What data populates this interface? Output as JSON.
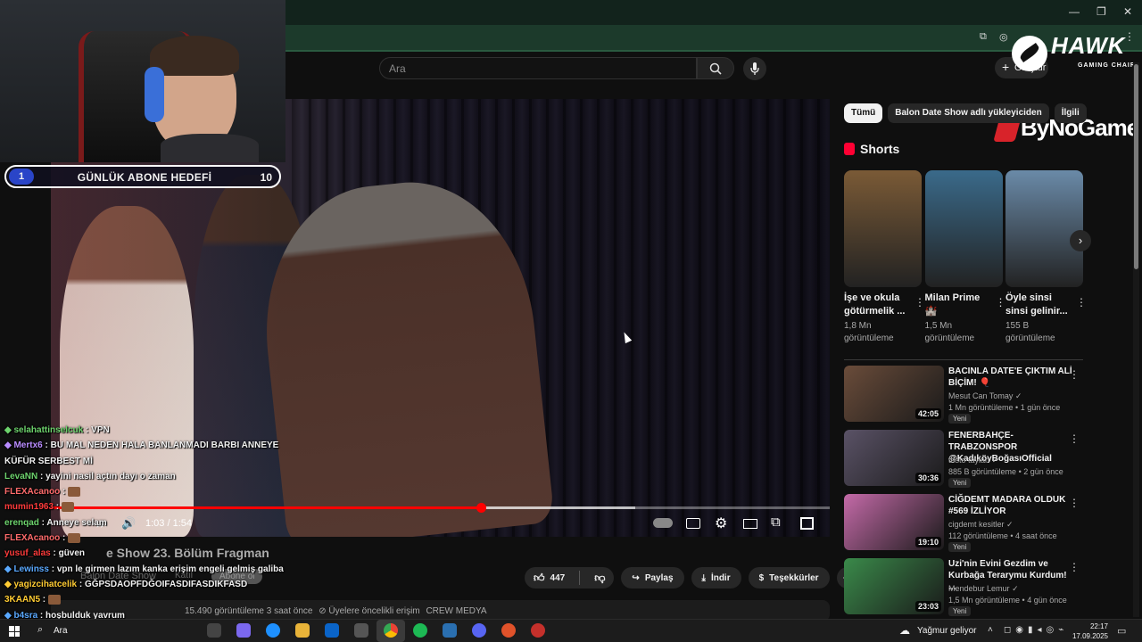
{
  "overlay": {
    "goal": {
      "current": "1",
      "label": "GÜNLÜK ABONE HEDEFİ",
      "target": "10",
      "fraction": 0.1
    },
    "brand_hawk": "HAWK",
    "brand_hawk_sub": "GAMING CHAIR",
    "brand_bynogame": "ByNoGame"
  },
  "chat": [
    {
      "user": "selahattinselcuk",
      "text": "VPN",
      "color": "#6dd36d",
      "badges": true
    },
    {
      "user": "Mertx6",
      "text": "BU MAL NEDEN HALA BANLANMADI BARBI ANNEYE KÜFÜR SERBEST Mİ",
      "color": "#b98cff",
      "badges": true
    },
    {
      "user": "LevaNN",
      "text": "yayini nasil açtın dayı o zaman",
      "color": "#6dd36d",
      "badges": false
    },
    {
      "user": "FLEXAcanoo",
      "text": "",
      "color": "#ff6b6b",
      "badges": false
    },
    {
      "user": "mumin1963",
      "text": "",
      "color": "#ff3b3b",
      "badges": false
    },
    {
      "user": "erenqad",
      "text": "Anneye selam",
      "color": "#6dd36d",
      "badges": false
    },
    {
      "user": "FLEXAcanoo",
      "text": "",
      "color": "#ff6b6b",
      "badges": false
    },
    {
      "user": "yusuf_alas",
      "text": "güven",
      "color": "#ff3b3b",
      "badges": false
    },
    {
      "user": "Lewinss",
      "text": "vpn le girmen lazım kanka erişim engeli gelmiş galiba",
      "color": "#5aa9ff",
      "badges": true
    },
    {
      "user": "yagizcihatcelik",
      "text": "GĞPSDAOPFDĞOIFASDIFASDIKFASD",
      "color": "#ffcc33",
      "badges": true
    },
    {
      "user": "3KAAN5",
      "text": "",
      "color": "#ffcc33",
      "badges": false
    },
    {
      "user": "b4sra",
      "text": "hoşbulduk yavrum",
      "color": "#5aa9ff",
      "badges": true
    }
  ],
  "youtube": {
    "search_placeholder": "Ara",
    "create_label": "Oluştur",
    "video": {
      "time": "1:03 / 1:54",
      "progress": 0.552,
      "buffered": 0.75,
      "title_visible": "e Show 23. Bölüm Fragman",
      "channel": "Balon Date Show",
      "join_label": "Katıl",
      "subscribe_label": "Abone ol",
      "likes": "447",
      "share_label": "Paylaş",
      "download_label": "İndir",
      "thanks_label": "Teşekkürler",
      "views_date": "15.490 görüntüleme 3 saat önce",
      "meta_extra": "Üyelere öncelikli erişim",
      "tag": "CREW MEDYA"
    },
    "chips": [
      "Tümü",
      "Balon Date Show adlı yükleyiciden",
      "İlgili"
    ],
    "shorts_title": "Shorts",
    "shorts": [
      {
        "title": "İşe ve okula götürmelik ...",
        "views": "1,8 Mn",
        "views_unit": "görüntüleme",
        "color": "#7a5a36"
      },
      {
        "title": "Milan Prime 🏰",
        "views": "1,5 Mn",
        "views_unit": "görüntüleme",
        "color": "#3a6a8a"
      },
      {
        "title": "Öyle sinsi sinsi gelinir...",
        "views": "155 B",
        "views_unit": "görüntüleme",
        "color": "#6a8aa8"
      }
    ],
    "videos": [
      {
        "title": "BACINLA DATE'E ÇIKTIM ALİ BİÇİM! 🎈",
        "channel": "Mesut Can Tomay",
        "views": "1 Mn görüntüleme",
        "age": "1 gün önce",
        "duration": "42:05",
        "new": "Yeni",
        "color": "#6a4c3a"
      },
      {
        "title": "FENERBAHÇE-TRABZONSPOR @KadıköyBoğasıOfficial",
        "channel": "testo taylan",
        "views": "885 B görüntüleme",
        "age": "2 gün önce",
        "duration": "30:36",
        "new": "Yeni",
        "color": "#5a5266"
      },
      {
        "title": "CİĞDEMT MADARA OLDUK #569 İZLİYOR",
        "channel": "cigdemt kesitler",
        "views": "112 görüntüleme",
        "age": "4 saat önce",
        "duration": "19:10",
        "new": "Yeni",
        "color": "#c46aa8"
      },
      {
        "title": "Uzi'nin Evini Gezdim ve Kurbağa Terarymu Kurdum! ...",
        "channel": "Mendebur Lemur",
        "views": "1,5 Mn görüntüleme",
        "age": "4 gün önce",
        "duration": "23:03",
        "new": "Yeni",
        "color": "#3a8a4a"
      }
    ]
  },
  "taskbar": {
    "search_label": "Ara",
    "weather": "Yağmur geliyor",
    "time": "22:17",
    "date": "17.09.2025"
  }
}
